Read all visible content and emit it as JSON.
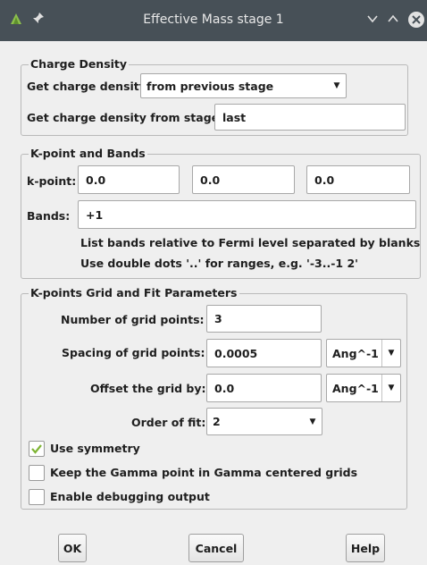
{
  "window": {
    "title": "Effective Mass stage 1"
  },
  "titlebar_icons": [
    "app-leaf-icon",
    "pin-icon",
    "minimize-icon",
    "maximize-icon",
    "close-icon"
  ],
  "charge_density": {
    "legend": "Charge Density",
    "get_label": "Get charge density",
    "get_value": "from previous stage",
    "stage_label": "Get charge density from stage:",
    "stage_value": "last"
  },
  "kpoint_bands": {
    "legend": "K-point and Bands",
    "kpoint_label": "k-point:",
    "kpoint_values": [
      "0.0",
      "0.0",
      "0.0"
    ],
    "bands_label": "Bands:",
    "bands_value": "+1",
    "note1": "List bands relative to Fermi level separated by blanks",
    "note2": "Use double dots '..' for ranges, e.g. '-3..-1 2'"
  },
  "grid": {
    "legend": "K-points Grid and Fit Parameters",
    "num_label": "Number of grid points:",
    "num_value": "3",
    "spacing_label": "Spacing of grid points:",
    "spacing_value": "0.0005",
    "spacing_unit": "Ang^-1",
    "offset_label": "Offset the grid by:",
    "offset_value": "0.0",
    "offset_unit": "Ang^-1",
    "order_label": "Order of fit:",
    "order_value": "2",
    "symmetry_label": "Use symmetry",
    "symmetry_checked": true,
    "gamma_label": "Keep the Gamma point in Gamma centered grids",
    "gamma_checked": false,
    "debug_label": "Enable debugging output",
    "debug_checked": false
  },
  "buttons": {
    "ok": "OK",
    "cancel": "Cancel",
    "help": "Help"
  },
  "colors": {
    "titlebar": "#475057",
    "check_accent": "#7fb535"
  }
}
